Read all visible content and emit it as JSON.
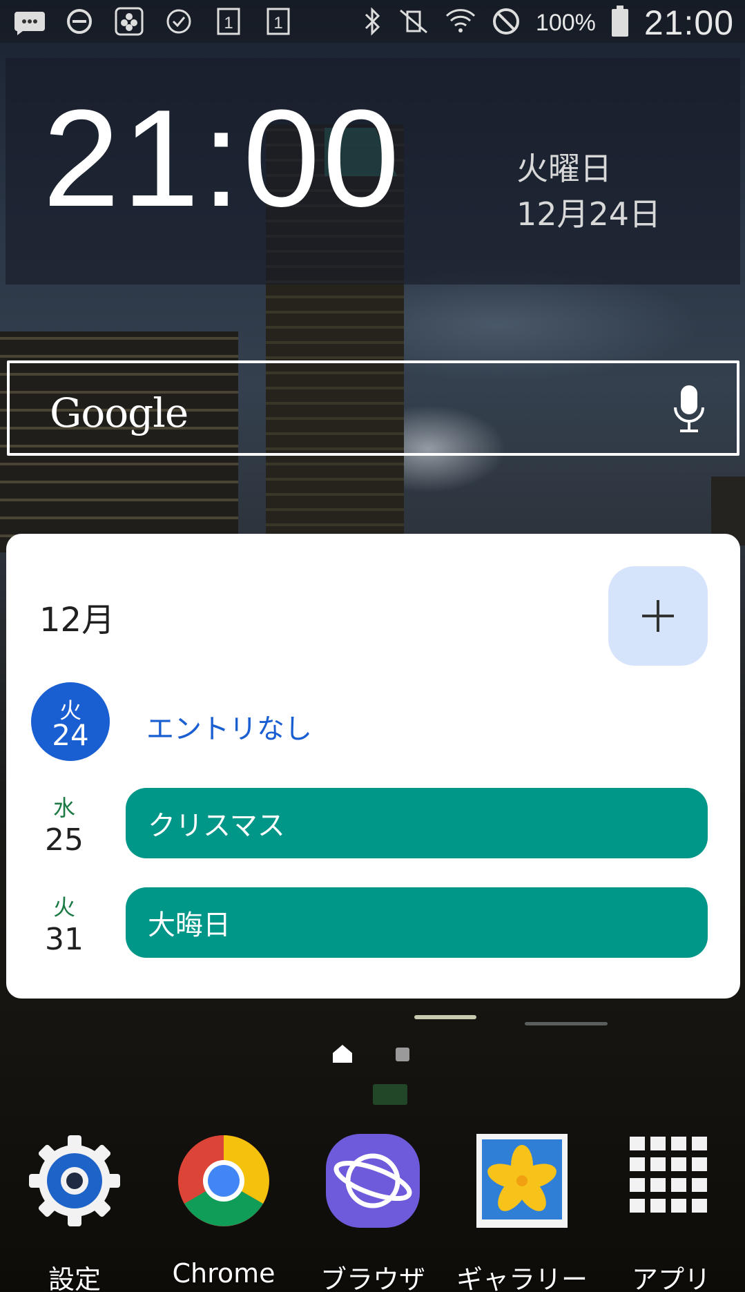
{
  "status_bar": {
    "left_icons": [
      "message-icon",
      "do-not-disturb-icon",
      "flower-app-icon",
      "check-circle-icon",
      "sim1-icon",
      "sim1-icon"
    ],
    "right_icons": [
      "bluetooth-icon",
      "vibrate-mute-icon",
      "wifi-icon",
      "blocked-icon"
    ],
    "battery_percent": "100%",
    "time": "21:00"
  },
  "clock_widget": {
    "time": "21:00",
    "weekday": "火曜日",
    "date": "12月24日"
  },
  "search": {
    "logo_text": "Google"
  },
  "calendar": {
    "month": "12月",
    "add_label": "+",
    "today": {
      "dow": "火",
      "day": "24",
      "text": "エントリなし"
    },
    "days": [
      {
        "dow": "水",
        "day": "25",
        "event": "クリスマス"
      },
      {
        "dow": "火",
        "day": "31",
        "event": "大晦日"
      }
    ],
    "today_color": "#1a5fd2",
    "event_color": "#009688"
  },
  "pager": {
    "pages": 2,
    "current": 1
  },
  "dock": [
    {
      "label": "設定",
      "icon": "settings-gear-icon"
    },
    {
      "label": "Chrome",
      "icon": "chrome-icon"
    },
    {
      "label": "ブラウザ",
      "icon": "browser-planet-icon"
    },
    {
      "label": "ギャラリー",
      "icon": "gallery-flower-icon"
    },
    {
      "label": "アプリ",
      "icon": "app-grid-icon"
    }
  ]
}
